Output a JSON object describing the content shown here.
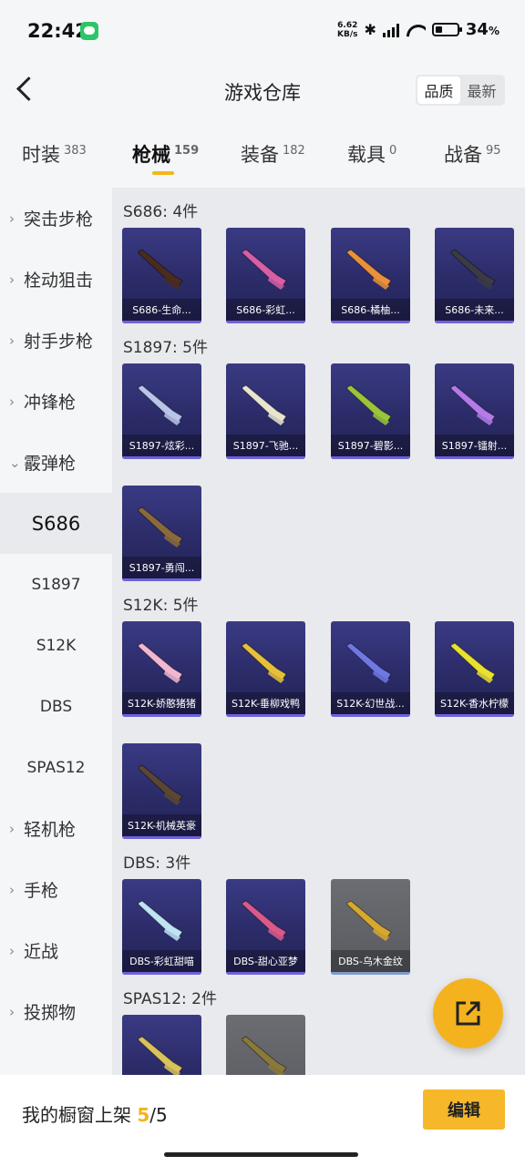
{
  "status": {
    "time": "22:42",
    "net_speed_value": "6.62",
    "net_speed_unit": "KB/s",
    "battery_percent": "34",
    "battery_suffix": "%",
    "battery_level": 0.34
  },
  "header": {
    "title": "游戏仓库",
    "sort_options": [
      "品质",
      "最新"
    ]
  },
  "tabs": [
    {
      "label": "时装",
      "count": "383"
    },
    {
      "label": "枪械",
      "count": "159"
    },
    {
      "label": "装备",
      "count": "182"
    },
    {
      "label": "载具",
      "count": "0"
    },
    {
      "label": "战备",
      "count": "95"
    }
  ],
  "sidebar": {
    "categories": [
      "突击步枪",
      "栓动狙击",
      "射手步枪",
      "冲锋枪",
      "霰弹枪"
    ],
    "subcategories": [
      "S686",
      "S1897",
      "S12K",
      "DBS",
      "SPAS12"
    ],
    "more_categories": [
      "轻机枪",
      "手枪",
      "近战",
      "投掷物"
    ]
  },
  "groups": [
    {
      "label": "S686: 4件",
      "items": [
        {
          "name": "S686-生命...",
          "color": "#4a2c1e"
        },
        {
          "name": "S686-彩虹...",
          "color": "#d75fa5"
        },
        {
          "name": "S686-橘柚...",
          "color": "#e9913a"
        },
        {
          "name": "S686-未来...",
          "color": "#3b3b45"
        }
      ]
    },
    {
      "label": "S1897: 5件",
      "items": [
        {
          "name": "S1897-炫彩...",
          "color": "#b8c4e8"
        },
        {
          "name": "S1897-飞驰...",
          "color": "#e8e4cf"
        },
        {
          "name": "S1897-碧影...",
          "color": "#9bc43a"
        },
        {
          "name": "S1897-镭射...",
          "color": "#b57be8"
        },
        {
          "name": "S1897-勇闯...",
          "color": "#8a6a3c"
        }
      ]
    },
    {
      "label": "S12K: 5件",
      "items": [
        {
          "name": "S12K-娇憨猪猪",
          "color": "#f2b7d0"
        },
        {
          "name": "S12K-垂柳戏鸭",
          "color": "#e6c03a"
        },
        {
          "name": "S12K-幻世战...",
          "color": "#6f78e2"
        },
        {
          "name": "S12K-香水柠檬",
          "color": "#e9e030"
        },
        {
          "name": "S12K-机械英豪",
          "color": "#5a4634"
        }
      ]
    },
    {
      "label": "DBS: 3件",
      "items": [
        {
          "name": "DBS-彩虹甜喵",
          "color": "#bfe4f4"
        },
        {
          "name": "DBS-甜心亚梦",
          "color": "#d95a8a"
        },
        {
          "name": "DBS-乌木金纹",
          "color": "#d6a830"
        }
      ]
    },
    {
      "label": "SPAS12: 2件",
      "items": [
        {
          "name": "",
          "color": "#d9c25a"
        },
        {
          "name": "",
          "color": "#8a7a3a"
        }
      ]
    }
  ],
  "bottom": {
    "shelf_label": "我的橱窗上架",
    "shelf_current": "5",
    "shelf_sep_total": "/5",
    "edit_label": "编辑"
  }
}
